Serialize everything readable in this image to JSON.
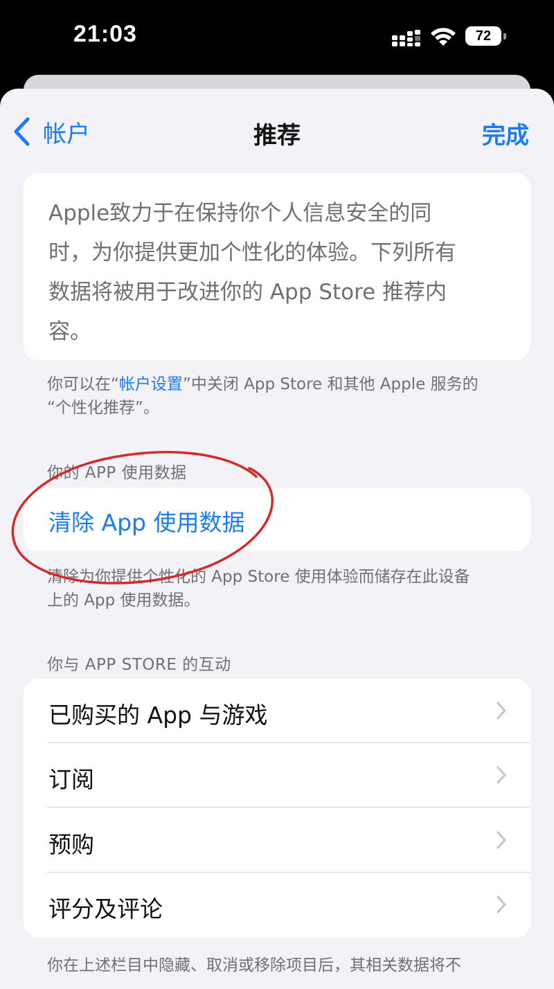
{
  "status_bar": {
    "time": "21:03",
    "battery": "72"
  },
  "nav": {
    "back_label": "帐户",
    "title": "推荐",
    "done_label": "完成"
  },
  "intro": {
    "lines": [
      "Apple致力于在保持你个人信息安全的同",
      "时，为你提供更加个性化的体验。下列所有",
      "数据将被用于改进你的 App Store 推荐内",
      "容。"
    ]
  },
  "settings_note": {
    "prefix": "你可以在“",
    "link": "帐户设置",
    "suffix": "”中关闭 App Store 和其他 Apple 服务的",
    "line2": "“个性化推荐”。"
  },
  "app_usage": {
    "header": "你的 APP 使用数据",
    "clear_label": "清除 App 使用数据",
    "footnote_line1": "清除为你提供个性化的 App Store 使用体验而储存在此设备",
    "footnote_line2": "上的 App 使用数据。"
  },
  "interactions": {
    "header": "你与 APP STORE 的互动",
    "items": [
      {
        "label": "已购买的 App 与游戏"
      },
      {
        "label": "订阅"
      },
      {
        "label": "预购"
      },
      {
        "label": "评分及评论"
      }
    ]
  },
  "bottom_note": "你在上述栏目中隐藏、取消或移除项目后，其相关数据将不",
  "colors": {
    "accent": "#1a7bf2",
    "annotation": "#d42a2a",
    "background": "#f2f2f7"
  }
}
